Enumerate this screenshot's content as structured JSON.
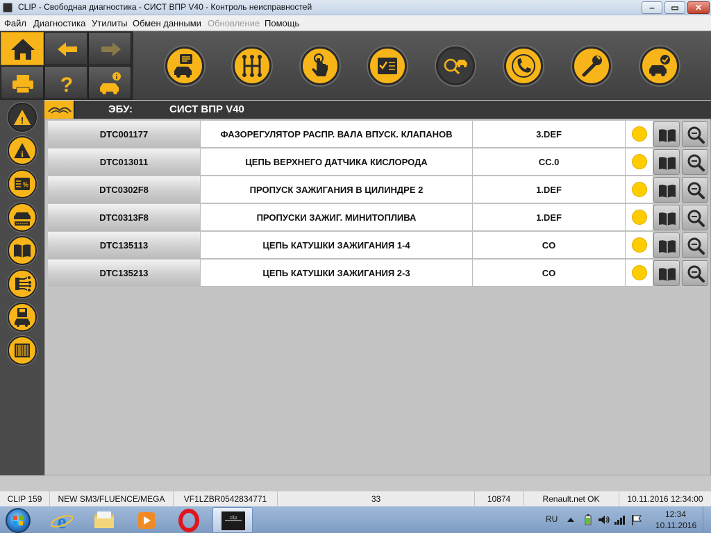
{
  "window": {
    "title": "CLIP - Свободная диагностика - СИСТ ВПР V40 - Контроль неисправностей",
    "minimize_glyph": "‒",
    "maximize_glyph": "▭",
    "close_glyph": "✕"
  },
  "menu": {
    "items": [
      {
        "label": "Файл",
        "enabled": true
      },
      {
        "label": "Диагностика",
        "enabled": true
      },
      {
        "label": "Утилиты",
        "enabled": true
      },
      {
        "label": "Обмен данными",
        "enabled": true
      },
      {
        "label": "Обновление",
        "enabled": false
      },
      {
        "label": "Помощь",
        "enabled": true
      }
    ]
  },
  "toolbar": {
    "nav_buttons": [
      "home-icon",
      "back-arrow-icon",
      "forward-arrow-icon",
      "printer-icon",
      "help-question-icon",
      "vehicle-info-icon"
    ],
    "tool_buttons": [
      "vehicle-id-icon",
      "gearbox-shift-icon",
      "touch-hand-icon",
      "checklist-icon",
      "fault-search-car-icon",
      "phone-support-icon",
      "wrench-icon",
      "vehicle-check-icon"
    ],
    "active_tool": "fault-search-car-icon"
  },
  "sidebar": {
    "items": [
      "fault-warning-icon",
      "info-warning-icon",
      "parameters-percent-icon",
      "vehicle-status-icon",
      "manual-book-icon",
      "wiring-icon",
      "save-vehicle-icon",
      "barcode-icon"
    ],
    "active_item": "fault-warning-icon"
  },
  "ecu": {
    "label": "ЭБУ:",
    "value": "СИСТ ВПР V40"
  },
  "faults": [
    {
      "code": "DTC001177",
      "description": "ФАЗОРЕГУЛЯТОР РАСПР. ВАЛА ВПУСК. КЛАПАНОВ",
      "status": "3.DEF"
    },
    {
      "code": "DTC013011",
      "description": "ЦЕПЬ ВЕРХНЕГО ДАТЧИКА КИСЛОРОДА",
      "status": "CC.0"
    },
    {
      "code": "DTC0302F8",
      "description": "ПРОПУСК ЗАЖИГАНИЯ В ЦИЛИНДРЕ 2",
      "status": "1.DEF"
    },
    {
      "code": "DTC0313F8",
      "description": "ПРОПУСКИ ЗАЖИГ. МИНИТОПЛИВА",
      "status": "1.DEF"
    },
    {
      "code": "DTC135113",
      "description": "ЦЕПЬ КАТУШКИ ЗАЖИГАНИЯ 1-4",
      "status": "CO"
    },
    {
      "code": "DTC135213",
      "description": "ЦЕПЬ КАТУШКИ ЗАЖИГАНИЯ 2-3",
      "status": "CO"
    }
  ],
  "colors": {
    "accent": "#f7b519",
    "indicator": "#ffcc00"
  },
  "statusbar": {
    "version": "CLIP 159",
    "vehicle": "NEW SM3/FLUENCE/MEGA",
    "vin": "VF1LZBR0542834771",
    "count": "33",
    "number": "10874",
    "connection": "Renault.net OK",
    "datetime": "10.11.2016 12:34:00"
  },
  "taskbar": {
    "apps": [
      "internet-explorer-icon",
      "file-explorer-icon",
      "media-player-icon",
      "opera-icon",
      "clip-app-icon"
    ],
    "active_app": "clip-app-icon",
    "language": "RU",
    "time": "12:34",
    "date": "10.11.2016"
  }
}
